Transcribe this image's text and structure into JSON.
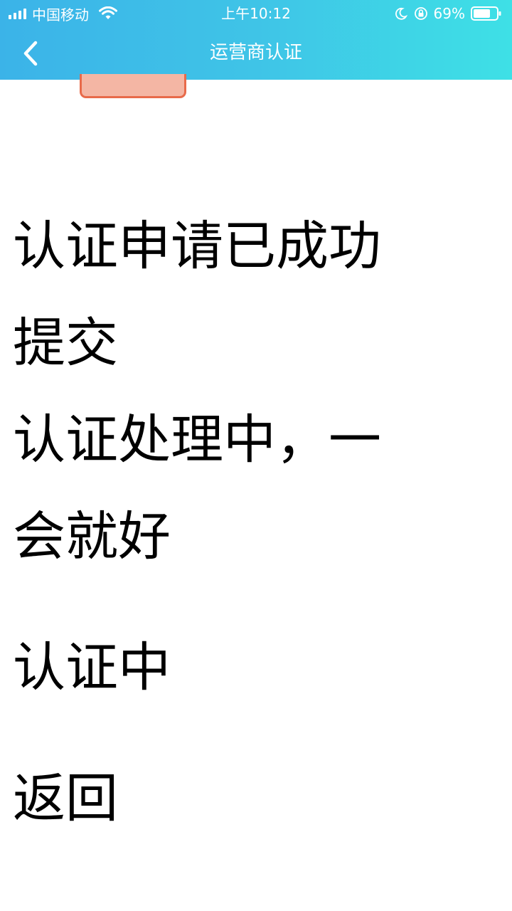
{
  "status_bar": {
    "carrier": "中国移动",
    "time": "上午10:12",
    "battery": "69%"
  },
  "navbar": {
    "title": "运营商认证"
  },
  "colors": {
    "header_gradient_start": "#3bb3e8",
    "header_gradient_end": "#3ee0e6",
    "partial_button_fill": "#f4b6a4",
    "partial_button_border": "#e86a4a"
  },
  "main": {
    "line1": "认证申请已成功",
    "line2": "提交",
    "line3": "认证处理中，一",
    "line4": "会就好",
    "status": "认证中",
    "back_link": "返回"
  },
  "icons": [
    "signal-icon",
    "wifi-icon",
    "moon-icon",
    "orientation-lock-icon",
    "battery-icon",
    "back-chevron-icon"
  ]
}
